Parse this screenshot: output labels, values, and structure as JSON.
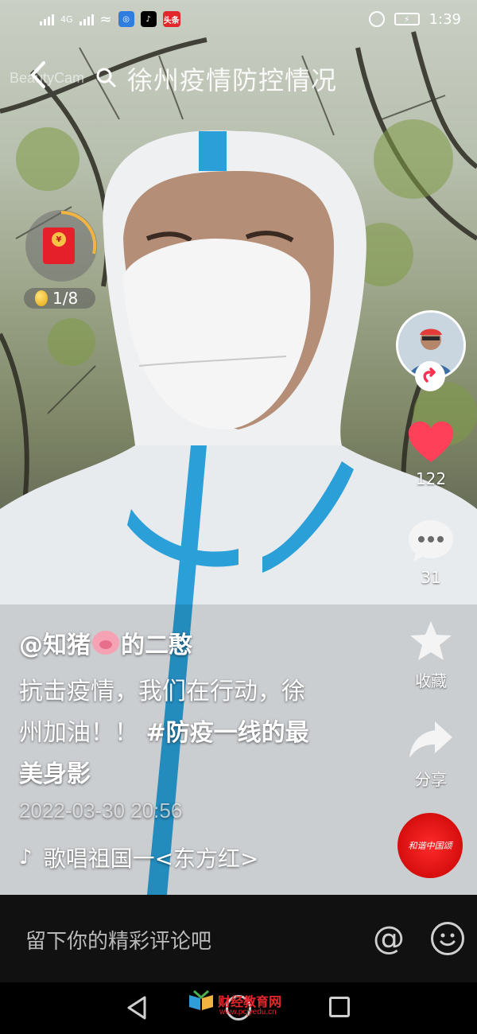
{
  "status_bar": {
    "network": "4G",
    "time": "1:39",
    "app_badges": [
      "头条"
    ]
  },
  "top_bar": {
    "watermark": "BeautyCam",
    "search_title": "徐州疫情防控情况"
  },
  "red_packet": {
    "seal": "¥",
    "progress": "1/8"
  },
  "actions": {
    "likes": "122",
    "comments": "31",
    "favorite_label": "收藏",
    "share_label": "分享"
  },
  "post": {
    "username_prefix": "@知猪",
    "username_suffix": "的二憨",
    "description": "抗击疫情，我们在行动，徐州加油！！",
    "hashtag": "#防疫一线的最美身影",
    "timestamp": "2022-03-30 20:56",
    "music": "歌唱祖国一<东方红>"
  },
  "music_disc_label": "和谐中国颂",
  "comment_bar": {
    "placeholder": "留下你的精彩评论吧"
  },
  "watermark_site": {
    "name": "财经教育网",
    "url": "www.pcjyedu.cn"
  },
  "colors": {
    "like_red": "#ff4058",
    "disc_red": "#e01414",
    "suit_blue": "#2a9fd8"
  }
}
